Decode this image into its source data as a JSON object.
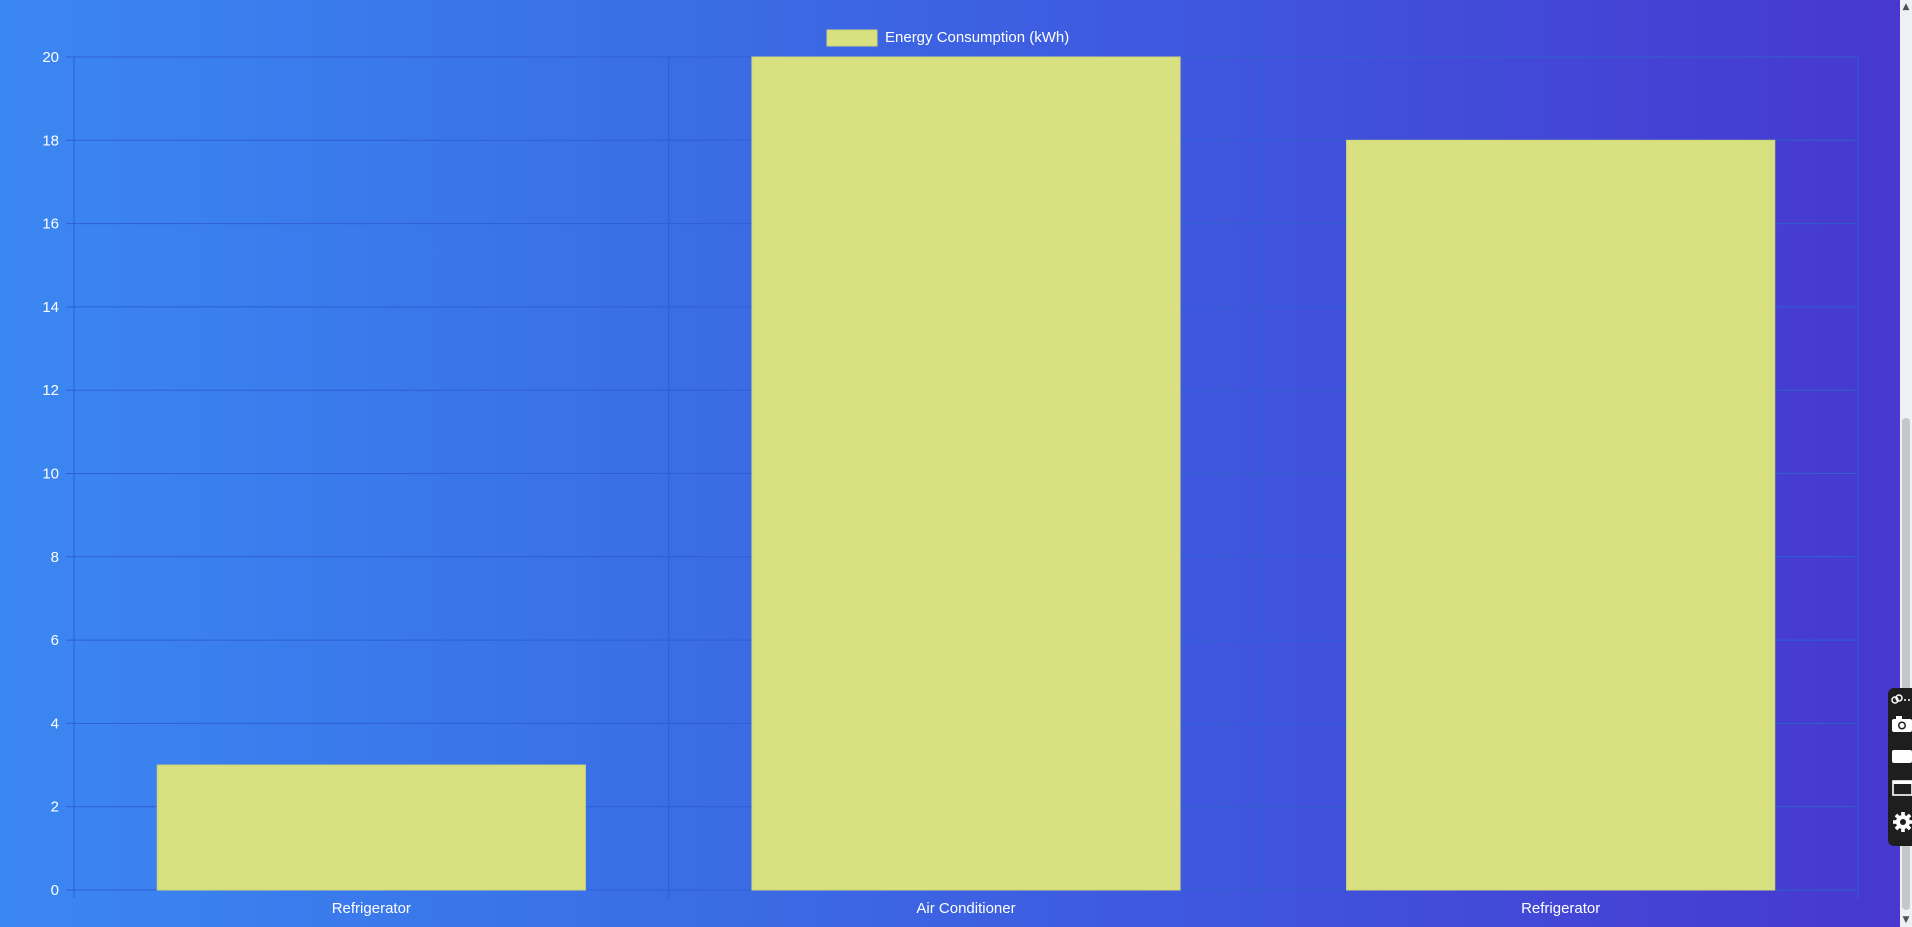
{
  "chart_data": {
    "type": "bar",
    "categories": [
      "Refrigerator",
      "Air Conditioner",
      "Refrigerator"
    ],
    "series": [
      {
        "name": "Energy Consumption (kWh)",
        "values": [
          3,
          20,
          18
        ]
      }
    ],
    "title": "",
    "xlabel": "",
    "ylabel": "",
    "ylim": [
      0,
      20
    ],
    "yticks": [
      0,
      2,
      4,
      6,
      8,
      10,
      12,
      14,
      16,
      18,
      20
    ],
    "grid": true,
    "legend": "top-center",
    "colors": {
      "bar_fill": "#d8e080",
      "bar_border": "#cfd67a",
      "grid": "#2f5fd0",
      "text": "#ffffff"
    }
  },
  "tools": {
    "items": [
      "link-icon",
      "camera-icon",
      "video-icon",
      "window-icon",
      "gear-icon"
    ]
  }
}
